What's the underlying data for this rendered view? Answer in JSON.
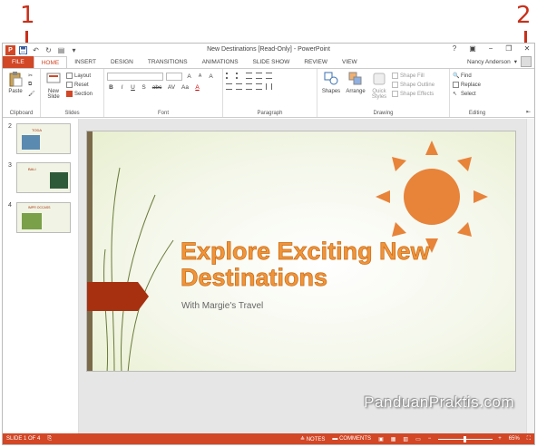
{
  "callouts": {
    "one": "1",
    "two": "2"
  },
  "window": {
    "title": "New Destinations [Read-Only] - PowerPoint",
    "app_icon": "P"
  },
  "quick_access": [
    "save-icon",
    "undo-icon",
    "redo-icon",
    "start-from-beginning-icon",
    "customize-icon"
  ],
  "window_controls": {
    "help": "?",
    "ribbon_display": "▣",
    "minimize": "−",
    "restore": "❐",
    "close": "✕"
  },
  "tabs": [
    "FILE",
    "HOME",
    "INSERT",
    "DESIGN",
    "TRANSITIONS",
    "ANIMATIONS",
    "SLIDE SHOW",
    "REVIEW",
    "VIEW"
  ],
  "active_tab": "HOME",
  "user": {
    "name": "Nancy Anderson"
  },
  "ribbon": {
    "clipboard": {
      "label": "Clipboard",
      "paste": "Paste"
    },
    "slides": {
      "label": "Slides",
      "new_slide_line1": "New",
      "new_slide_line2": "Slide",
      "layout": "Layout",
      "reset": "Reset",
      "section": "Section"
    },
    "font": {
      "label": "Font",
      "bold": "B",
      "italic": "I",
      "underline": "U",
      "shadow": "S",
      "strike": "abc",
      "spacing": "AV",
      "case": "Aa",
      "grow": "A",
      "shrink": "A",
      "clear": "A",
      "color": "A"
    },
    "paragraph": {
      "label": "Paragraph"
    },
    "drawing": {
      "label": "Drawing",
      "shapes": "Shapes",
      "arrange": "Arrange",
      "quick_styles_line1": "Quick",
      "quick_styles_line2": "Styles",
      "shape_fill": "Shape Fill",
      "shape_outline": "Shape Outline",
      "shape_effects": "Shape Effects"
    },
    "editing": {
      "label": "Editing",
      "find": "Find",
      "replace": "Replace",
      "select": "Select"
    }
  },
  "thumbnails": [
    {
      "num": "2",
      "title": "TODA"
    },
    {
      "num": "3",
      "title": "BALI"
    },
    {
      "num": "4",
      "title": "IMPR OCCASS"
    }
  ],
  "slide": {
    "title_line1": "Explore Exciting New",
    "title_line2": "Destinations",
    "subtitle": "With Margie's Travel"
  },
  "colors": {
    "accent": "#d24726",
    "sun": "#e8833a",
    "ribbon_banner": "#a63010",
    "bar": "#7a6a4a"
  },
  "status": {
    "slide_info": "SLIDE 1 OF 4",
    "notes": "NOTES",
    "comments": "COMMENTS",
    "zoom": "65%"
  },
  "watermark": "PanduanPraktis.com"
}
